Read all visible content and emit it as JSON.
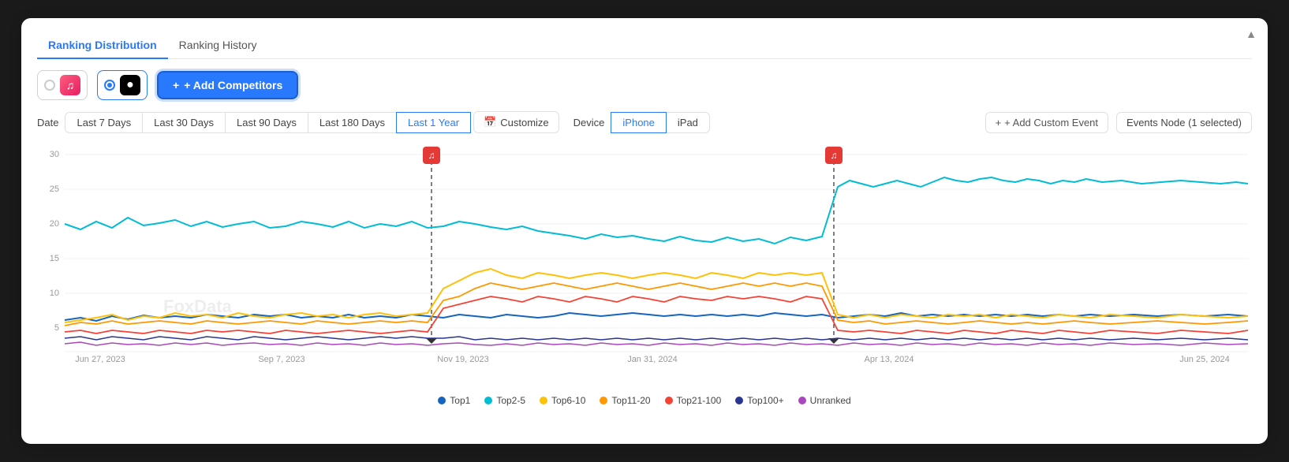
{
  "card": {
    "collapse_icon": "▲"
  },
  "tabs": [
    {
      "label": "Ranking Distribution",
      "active": true
    },
    {
      "label": "Ranking History",
      "active": false
    }
  ],
  "apps": [
    {
      "id": "music",
      "icon": "♫",
      "type": "music",
      "checked": false
    },
    {
      "id": "spotify",
      "icon": "●",
      "type": "spotify",
      "checked": true
    }
  ],
  "add_competitors_btn": "+ Add Competitors",
  "date_filters": {
    "label": "Date",
    "options": [
      {
        "label": "Last 7 Days",
        "active": false
      },
      {
        "label": "Last 30 Days",
        "active": false
      },
      {
        "label": "Last 90 Days",
        "active": false
      },
      {
        "label": "Last 180 Days",
        "active": false
      },
      {
        "label": "Last 1 Year",
        "active": true
      }
    ],
    "customize_label": "Customize",
    "customize_icon": "📅"
  },
  "device_filters": {
    "label": "Device",
    "options": [
      {
        "label": "iPhone",
        "active": true
      },
      {
        "label": "iPad",
        "active": false
      }
    ]
  },
  "right_actions": {
    "add_event_label": "+ Add Custom Event",
    "events_node_label": "Events Node (1 selected)"
  },
  "chart": {
    "y_labels": [
      "30",
      "25",
      "20",
      "15",
      "10",
      "5"
    ],
    "x_labels": [
      "Jun 27, 2023",
      "Sep 7, 2023",
      "Nov 19, 2023",
      "Jan 31, 2024",
      "Apr 13, 2024",
      "Jun 25, 2024"
    ],
    "watermark": "FoxData",
    "event_markers": [
      {
        "x_pct": 32
      },
      {
        "x_pct": 65
      }
    ]
  },
  "legend": [
    {
      "label": "Top1",
      "color": "#1565c0"
    },
    {
      "label": "Top2-5",
      "color": "#00bcd4"
    },
    {
      "label": "Top6-10",
      "color": "#ffc107"
    },
    {
      "label": "Top11-20",
      "color": "#ff9800"
    },
    {
      "label": "Top21-100",
      "color": "#f44336"
    },
    {
      "label": "Top100+",
      "color": "#1a237e"
    },
    {
      "label": "Unranked",
      "color": "#ab47bc"
    }
  ]
}
